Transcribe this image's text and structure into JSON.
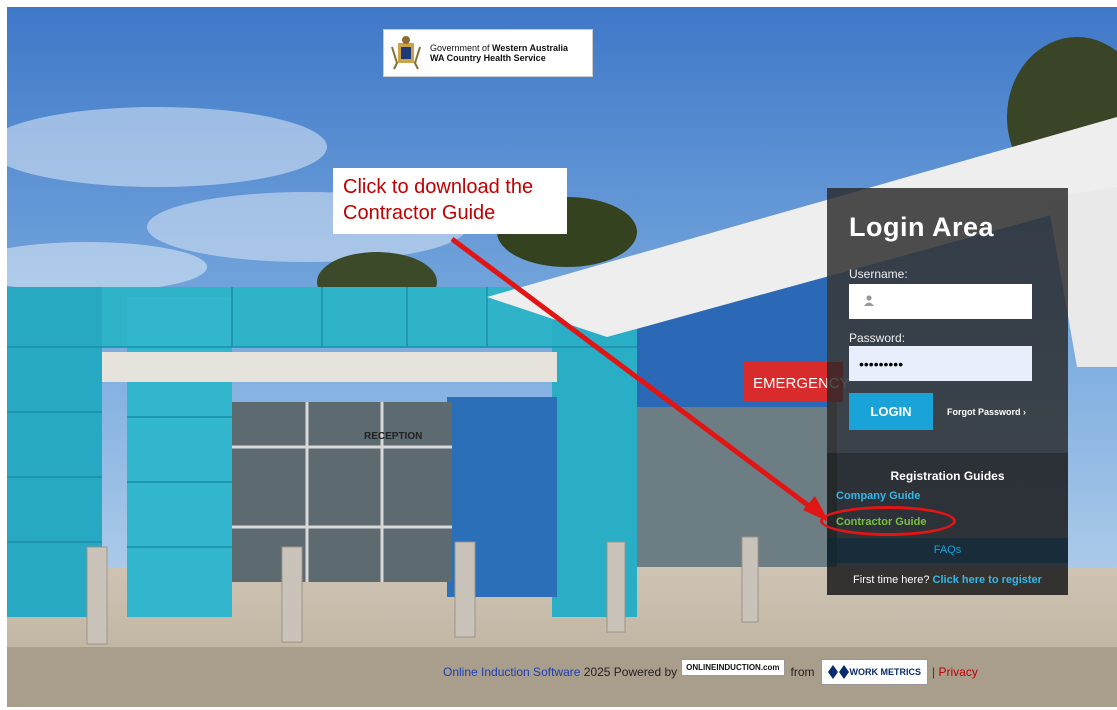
{
  "logo": {
    "line1_prefix": "Government of ",
    "line1_bold": "Western Australia",
    "line2": "WA Country Health Service"
  },
  "callout": {
    "text_line1": "Click to download the",
    "text_line2": "Contractor Guide"
  },
  "building": {
    "emergency_sign": "EMERGENCY",
    "reception_sign": "RECEPTION"
  },
  "login": {
    "title": "Login Area",
    "username_label": "Username:",
    "username_value": "",
    "password_label": "Password:",
    "password_value": "•••••••••",
    "login_button": "LOGIN",
    "forgot_password": "Forgot Password",
    "forgot_arrow": "›"
  },
  "registration": {
    "title": "Registration Guides",
    "company_guide": "Company Guide",
    "contractor_guide": "Contractor Guide",
    "faqs": "FAQs",
    "first_time": "First time here?",
    "register_link": "Click here to register"
  },
  "footer": {
    "software_link": "Online Induction Software",
    "year_text": "2025 Powered by",
    "oi_logo": "ONLINEINDUCTION.com",
    "from": "from",
    "wm_logo": "WORK METRICS",
    "separator": "|",
    "privacy": "Privacy"
  },
  "colors": {
    "accent_blue": "#1aa3d9",
    "highlight_red": "#e21515",
    "contractor_green": "#7bc043"
  }
}
